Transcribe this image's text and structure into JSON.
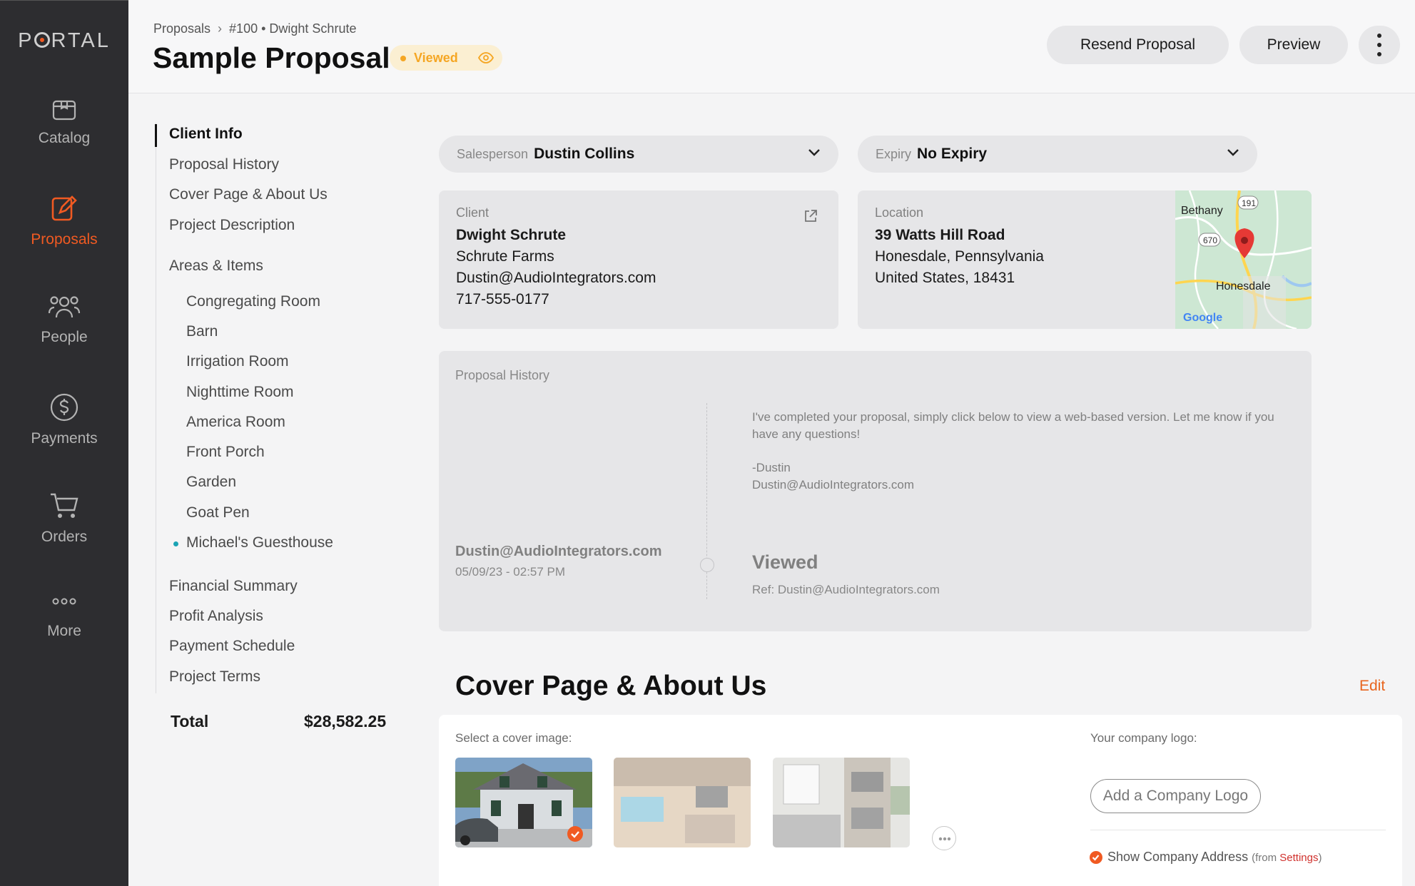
{
  "app": {
    "logo": "PORTAL",
    "accent": "#f05a22",
    "nav": [
      {
        "label": "Catalog",
        "icon": "catalog-icon",
        "active": false
      },
      {
        "label": "Proposals",
        "icon": "proposal-edit-icon",
        "active": true
      },
      {
        "label": "People",
        "icon": "people-icon",
        "active": false
      },
      {
        "label": "Payments",
        "icon": "dollar-icon",
        "active": false
      },
      {
        "label": "Orders",
        "icon": "cart-icon",
        "active": false
      },
      {
        "label": "More",
        "icon": "more-dots-icon",
        "active": false
      }
    ]
  },
  "header": {
    "breadcrumb": {
      "root": "Proposals",
      "number": "#100",
      "client": "Dwight Schrute"
    },
    "title": "Sample Proposal",
    "status": "Viewed",
    "status_color": "#f5a623",
    "actions": {
      "resend": "Resend Proposal",
      "preview": "Preview"
    }
  },
  "sections": {
    "main": [
      "Client Info",
      "Proposal History",
      "Cover Page & About Us",
      "Project Description"
    ],
    "areas_label": "Areas & Items",
    "areas": [
      "Congregating Room",
      "Barn",
      "Irrigation Room",
      "Nighttime Room",
      "America Room",
      "Front Porch",
      "Garden",
      "Goat Pen",
      "Michael's Guesthouse"
    ],
    "footer": [
      "Financial Summary",
      "Profit Analysis",
      "Payment Schedule",
      "Project Terms"
    ],
    "total_label": "Total",
    "total_value": "$28,582.25"
  },
  "selects": {
    "salesperson": {
      "label": "Salesperson",
      "value": "Dustin Collins"
    },
    "expiry": {
      "label": "Expiry",
      "value": "No Expiry"
    }
  },
  "client": {
    "caption": "Client",
    "name": "Dwight Schrute",
    "company": "Schrute Farms",
    "email": "Dustin@AudioIntegrators.com",
    "phone": "717-555-0177"
  },
  "location": {
    "caption": "Location",
    "street": "39 Watts Hill Road",
    "city": "Honesdale, Pennsylvania",
    "country": "United States, 18431",
    "map": {
      "town1": "Bethany",
      "town2": "Honesdale",
      "route1": "191",
      "route2": "670",
      "brand": "Google"
    }
  },
  "history": {
    "caption": "Proposal History",
    "message": {
      "line1": "I've completed your proposal, simply click below to view a web-based version. Let me know if you",
      "line2": "have any questions!",
      "sign": "-Dustin",
      "email": "Dustin@AudioIntegrators.com"
    },
    "event": {
      "sender": "Dustin@AudioIntegrators.com",
      "date": "05/09/23 - 02:57 PM",
      "status": "Viewed",
      "ref": "Ref: Dustin@AudioIntegrators.com"
    }
  },
  "cover": {
    "title": "Cover Page & About Us",
    "edit": "Edit",
    "select_image": "Select a cover image:",
    "logo_caption": "Your company logo:",
    "add_logo": "Add a Company Logo",
    "show_address": "Show Company Address",
    "from_open": "(from ",
    "settings": "Settings",
    "from_close": ")"
  }
}
